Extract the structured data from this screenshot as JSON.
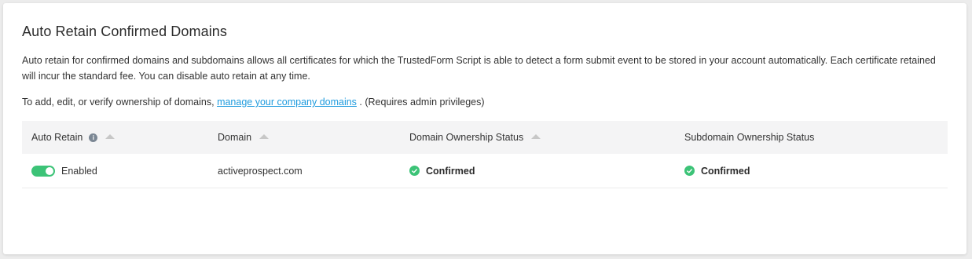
{
  "card": {
    "title": "Auto Retain Confirmed Domains",
    "description": "Auto retain for confirmed domains and subdomains allows all certificates for which the TrustedForm Script is able to detect a form submit event to be stored in your account automatically. Each certificate retained will incur the standard fee. You can disable auto retain at any time.",
    "note_prefix": "To add, edit, or verify ownership of domains,",
    "note_link": "manage your company domains",
    "note_suffix": ". (Requires admin privileges)"
  },
  "table": {
    "headers": {
      "auto_retain": "Auto Retain",
      "domain": "Domain",
      "domain_status": "Domain Ownership Status",
      "subdomain_status": "Subdomain Ownership Status"
    },
    "rows": [
      {
        "auto_retain": "Enabled",
        "domain": "activeprospect.com",
        "domain_status": "Confirmed",
        "subdomain_status": "Confirmed"
      }
    ]
  },
  "colors": {
    "accent_green": "#3cc377",
    "link_blue": "#1f9bde",
    "header_bg": "#f4f4f5"
  },
  "icons": [
    "info-icon",
    "sort-up-icon",
    "check-circle-icon",
    "toggle-switch"
  ]
}
